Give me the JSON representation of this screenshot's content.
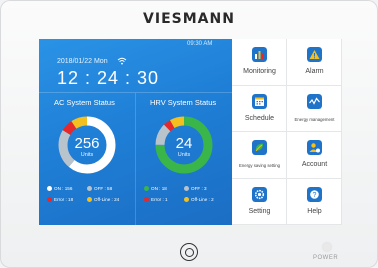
{
  "device": {
    "brand": "VIESMANN",
    "power_label": "POWER"
  },
  "status_bar": {
    "time_small": "09:30  AM",
    "date": "2018/01/22  Mon",
    "clock": "12 : 24 : 30",
    "wifi_icon": "wifi-icon"
  },
  "ac_system": {
    "title": "AC System Status",
    "total": "256",
    "unit": "Units",
    "legend": [
      {
        "label": "ON : 156",
        "color": "#ffffff",
        "value": 156
      },
      {
        "label": "OFF : 58",
        "color": "#b9c3cc",
        "value": 58
      },
      {
        "label": "Error : 18",
        "color": "#e5282b",
        "value": 18
      },
      {
        "label": "Off-Line : 24",
        "color": "#f4c020",
        "value": 24
      }
    ]
  },
  "hrv_system": {
    "title": "HRV System Status",
    "total": "24",
    "unit": "Units",
    "legend": [
      {
        "label": "ON : 18",
        "color": "#3ab54a",
        "value": 18
      },
      {
        "label": "OFF : 3",
        "color": "#b9c3cc",
        "value": 3
      },
      {
        "label": "Error : 1",
        "color": "#e5282b",
        "value": 1
      },
      {
        "label": "Off-Line : 2",
        "color": "#f4c020",
        "value": 2
      }
    ]
  },
  "menu": [
    {
      "label": "Monitoring",
      "icon": "bar-chart-icon",
      "color": "#1f74c9"
    },
    {
      "label": "Alarm",
      "icon": "warning-icon",
      "color": "#1f74c9"
    },
    {
      "label": "Schedule",
      "icon": "calendar-icon",
      "color": "#1f74c9"
    },
    {
      "label": "Energy management",
      "icon": "energy-wave-icon",
      "color": "#1f74c9"
    },
    {
      "label": "Energy saving setting",
      "icon": "leaf-icon",
      "color": "#1f74c9"
    },
    {
      "label": "Account",
      "icon": "user-icon",
      "color": "#1f74c9"
    },
    {
      "label": "Setting",
      "icon": "gear-icon",
      "color": "#1f74c9"
    },
    {
      "label": "Help",
      "icon": "help-icon",
      "color": "#1f74c9"
    }
  ]
}
